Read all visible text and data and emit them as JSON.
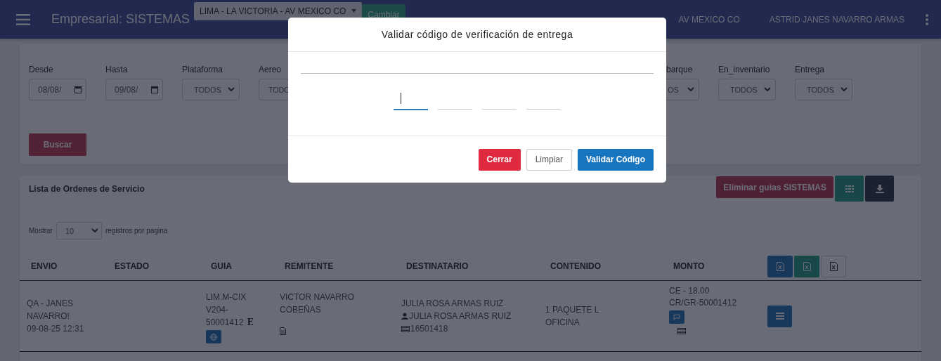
{
  "navbar": {
    "title": "Empresarial: SISTEMAS",
    "branch_select": "LIMA - LA VICTORIA - AV MEXICO CO",
    "change_button": "Cambiar",
    "branch": "AV MEXICO CO",
    "user": "ASTRID JANES NAVARRO ARMAS"
  },
  "filters": [
    {
      "label": "Desde",
      "kind": "date",
      "value": "08/08/"
    },
    {
      "label": "Hasta",
      "kind": "date",
      "value": "09/08/"
    },
    {
      "label": "Plataforma",
      "kind": "select",
      "value": "TODOS"
    },
    {
      "label": "Aereo",
      "kind": "select",
      "value": "TODO"
    },
    {
      "label": "barque",
      "kind": "select",
      "value": "OS"
    },
    {
      "label": "En_inventario",
      "kind": "select",
      "value": "TODOS"
    },
    {
      "label": "Entrega",
      "kind": "select",
      "value": "TODOS"
    }
  ],
  "search_button": "Buscar",
  "list": {
    "title": "Lista de Ordenes de Servicio",
    "delete_button": "Eliminar guias SISTEMAS",
    "show_label": "Mostrar",
    "page_size": "10",
    "per_page_label": "registros por pagina"
  },
  "table": {
    "columns": [
      "ENVIO",
      "ESTADO",
      "GUIA",
      "REMITENTE",
      "DESTINATARIO",
      "CONTENIDO",
      "MONTO"
    ],
    "rows": [
      {
        "envio": [
          "QA - JANES",
          "NAVARRO!",
          "09-08-25 12:31"
        ],
        "guia": [
          "LIM.M-CIX",
          "V204-",
          "50001412"
        ],
        "guia_mark": "E",
        "remitente": [
          "VICTOR NAVARRO",
          "COBEÑAS"
        ],
        "destinatario": "JULIA ROSA ARMAS RUIZ",
        "contact": "JULIA ROSA ARMAS RUIZ",
        "document": "16501418",
        "contenido": [
          "1 PAQUETE L",
          "OFICINA"
        ],
        "monto": [
          "CE - 18.00",
          "CR/GR-50001412"
        ]
      }
    ]
  },
  "modal": {
    "title": "Validar código de verificación de entrega",
    "code_boxes": [
      {
        "focused": true
      },
      {
        "focused": false
      },
      {
        "focused": false
      },
      {
        "focused": false
      }
    ],
    "buttons": [
      {
        "label": "Cerrar",
        "kind": "danger"
      },
      {
        "label": "Limpiar",
        "kind": "light"
      },
      {
        "label": "Validar Código",
        "kind": "primary"
      }
    ]
  }
}
